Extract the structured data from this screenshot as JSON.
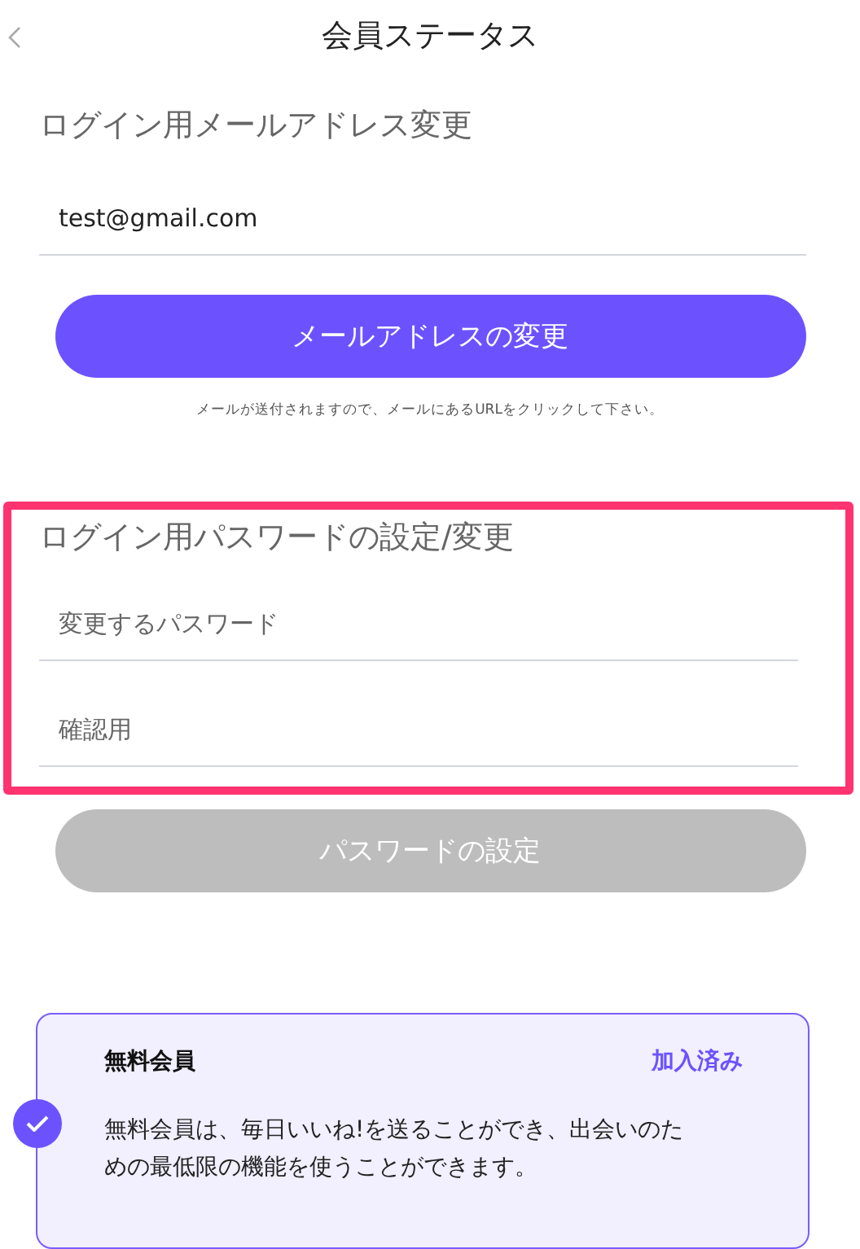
{
  "header": {
    "title": "会員ステータス"
  },
  "email_section": {
    "heading": "ログイン用メールアドレス変更",
    "email": "test@gmail.com",
    "button": {
      "label": "メールアドレスの変更",
      "disabled": false
    },
    "note": "メールが送付されますので、メールにあるURLをクリックして下さい。"
  },
  "password_section": {
    "highlighted": true,
    "heading": "ログイン用パスワードの設定/変更",
    "fields": [
      {
        "placeholder": "変更するパスワード"
      },
      {
        "placeholder": "確認用"
      }
    ],
    "button": {
      "label": "パスワードの設定",
      "disabled": true
    }
  },
  "plan": {
    "name": "無料会員",
    "status": "加入済み",
    "checked": true,
    "description": "無料会員は、毎日いいね!を送ることができ、出会いのための最低限の機能を使うことができます。"
  }
}
